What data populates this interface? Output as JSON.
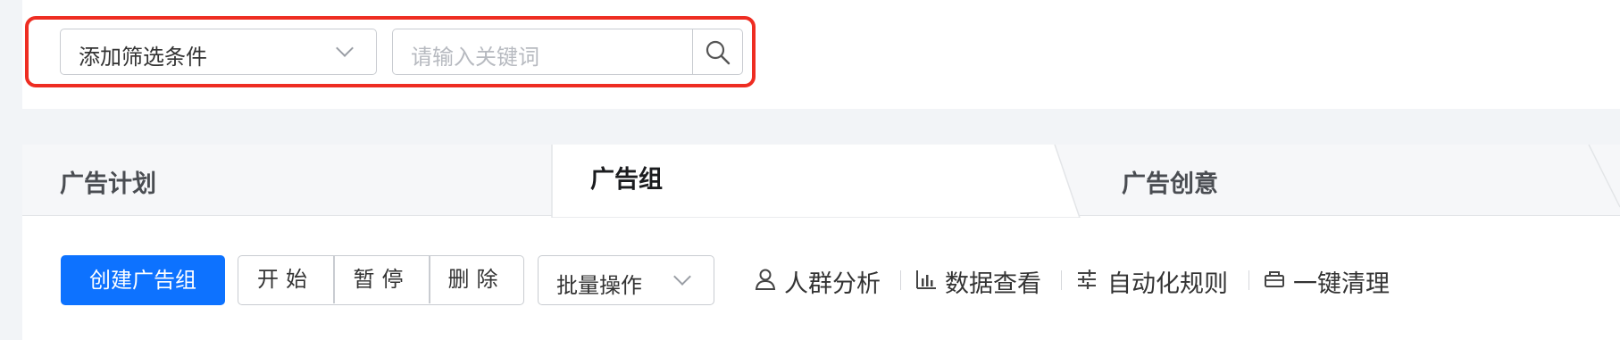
{
  "filter_bar": {
    "add_filter_label": "添加筛选条件",
    "search_placeholder": "请输入关键词"
  },
  "tabs": [
    {
      "label": "广告计划",
      "active": false
    },
    {
      "label": "广告组",
      "active": true
    },
    {
      "label": "广告创意",
      "active": false
    }
  ],
  "toolbar": {
    "create_label": "创建广告组",
    "start_label": "开始",
    "pause_label": "暂停",
    "delete_label": "删除",
    "batch_label": "批量操作",
    "links": [
      {
        "label": "人群分析",
        "icon": "user-icon"
      },
      {
        "label": "数据查看",
        "icon": "bar-chart-icon"
      },
      {
        "label": "自动化规则",
        "icon": "sliders-icon"
      },
      {
        "label": "一键清理",
        "icon": "broom-icon"
      }
    ]
  },
  "colors": {
    "primary": "#0d72ff",
    "highlight": "#ee2d22",
    "background": "#f2f4f7"
  }
}
